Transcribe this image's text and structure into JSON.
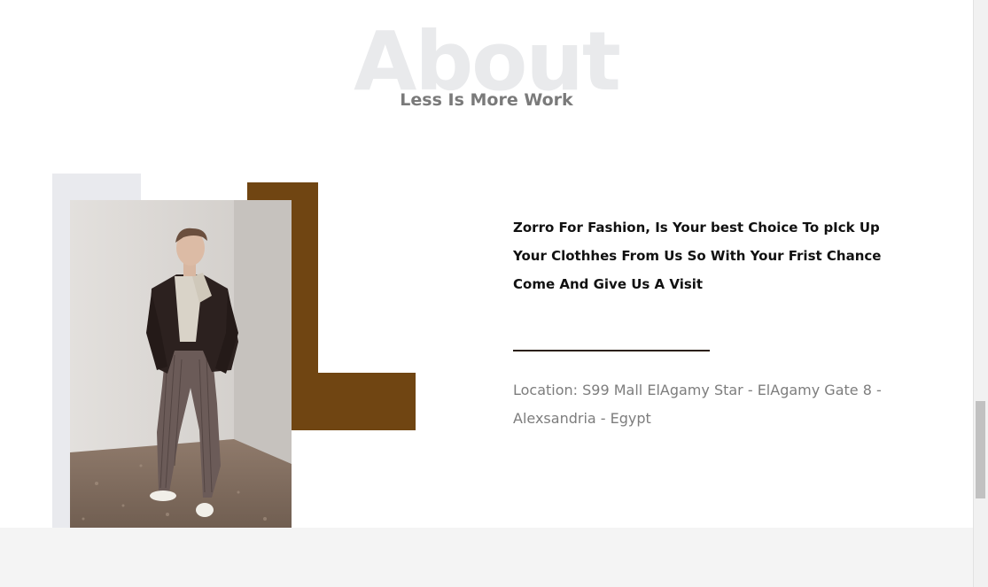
{
  "about": {
    "background_word": "About",
    "subtitle": "Less Is More Work"
  },
  "content": {
    "description": "Zorro For Fashion, Is Your best Choice To pIck Up Your Clothhes From Us So With Your Frist Chance Come And Give Us A Visit",
    "location": "Location: S99 Mall ElAgamy Star - ElAgamy Gate 8 - Alexsandria - Egypt"
  },
  "colors": {
    "accent_brown": "#704512",
    "light_gray_block": "#e9eaee",
    "background_word": "#e9eaec",
    "footer_band": "#f4f4f4"
  }
}
